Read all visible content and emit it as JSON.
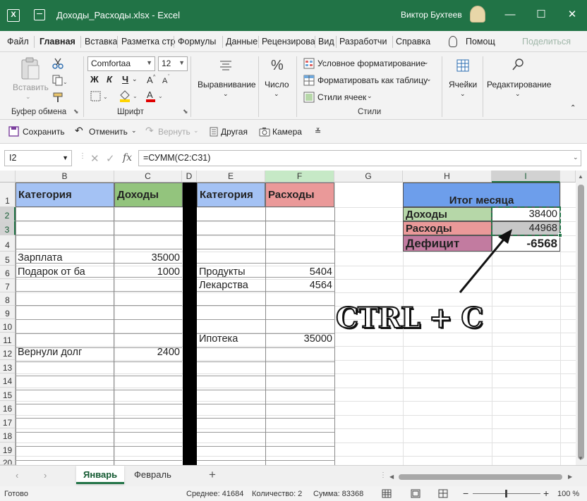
{
  "window": {
    "title": "Доходы_Расходы.xlsx  -  Excel",
    "user": "Виктор Бухтеев",
    "controls": [
      "—",
      "☐",
      "✕"
    ]
  },
  "tabs": [
    "Файл",
    "Главная",
    "Вставка",
    "Разметка стр",
    "Формулы",
    "Данные",
    "Рецензирова",
    "Вид",
    "Разработчи",
    "Справка"
  ],
  "tab_help": "Помощ",
  "tab_share": "Поделиться",
  "ribbon": {
    "paste": "Вставить",
    "clipboard_group": "Буфер обмена",
    "font_name": "Comfortaa",
    "font_size": "12",
    "bold": "Ж",
    "italic": "К",
    "underline": "Ч",
    "font_group": "Шрифт",
    "alignment": "Выравнивание",
    "number": "Число",
    "number_symbol": "%",
    "conditional": "Условное форматирование",
    "format_table": "Форматировать как таблицу",
    "cell_styles": "Стили ячеек",
    "styles_group": "Стили",
    "cells": "Ячейки",
    "editing": "Редактирование"
  },
  "qat": {
    "save": "Сохранить",
    "undo": "Отменить",
    "redo": "Вернуть",
    "other": "Другая",
    "camera": "Камера"
  },
  "formula_bar": {
    "name_box": "I2",
    "fx": "fx",
    "formula": "=СУММ(C2:C31)"
  },
  "columns": [
    "B",
    "C",
    "D",
    "E",
    "F",
    "G",
    "H",
    "I"
  ],
  "rows": [
    "1",
    "2",
    "3",
    "4",
    "5",
    "6",
    "7",
    "8",
    "9",
    "10",
    "11",
    "12",
    "13",
    "14",
    "15",
    "16",
    "17",
    "18",
    "19",
    "20"
  ],
  "cells": {
    "B1": "Категория",
    "C1": "Доходы",
    "E1": "Категория",
    "F1": "Расходы",
    "B5": "Зарплата",
    "C5": "35000",
    "B6": "Подарок от ба",
    "C6": "1000",
    "E6": "Продукты",
    "F6": "5404",
    "E7": "Лекарства",
    "F7": "4564",
    "E11": "Ипотека",
    "F11": "35000",
    "B12": "Вернули долг",
    "C12": "2400",
    "H1": "Итог месяца",
    "H2": "Доходы",
    "I2": "38400",
    "H3": "Расходы",
    "I3": "44968",
    "H4": "Дефицит",
    "I4": "-6568"
  },
  "colors": {
    "title_bar": "#217346",
    "income_header": "#93c47d",
    "category_header": "#a4c2f4",
    "expense_header": "#ea9999",
    "total_header": "#6d9eeb",
    "income_light": "#b6d7a8",
    "deficit": "#c27ba0"
  },
  "overlay_text": "CTRL + C",
  "sheets": [
    "Январь",
    "Февраль"
  ],
  "add_sheet": "+",
  "status": {
    "ready": "Готово",
    "average": "Среднее: 41684",
    "count": "Количество: 2",
    "sum": "Сумма: 83368",
    "zoom": "100 %"
  }
}
